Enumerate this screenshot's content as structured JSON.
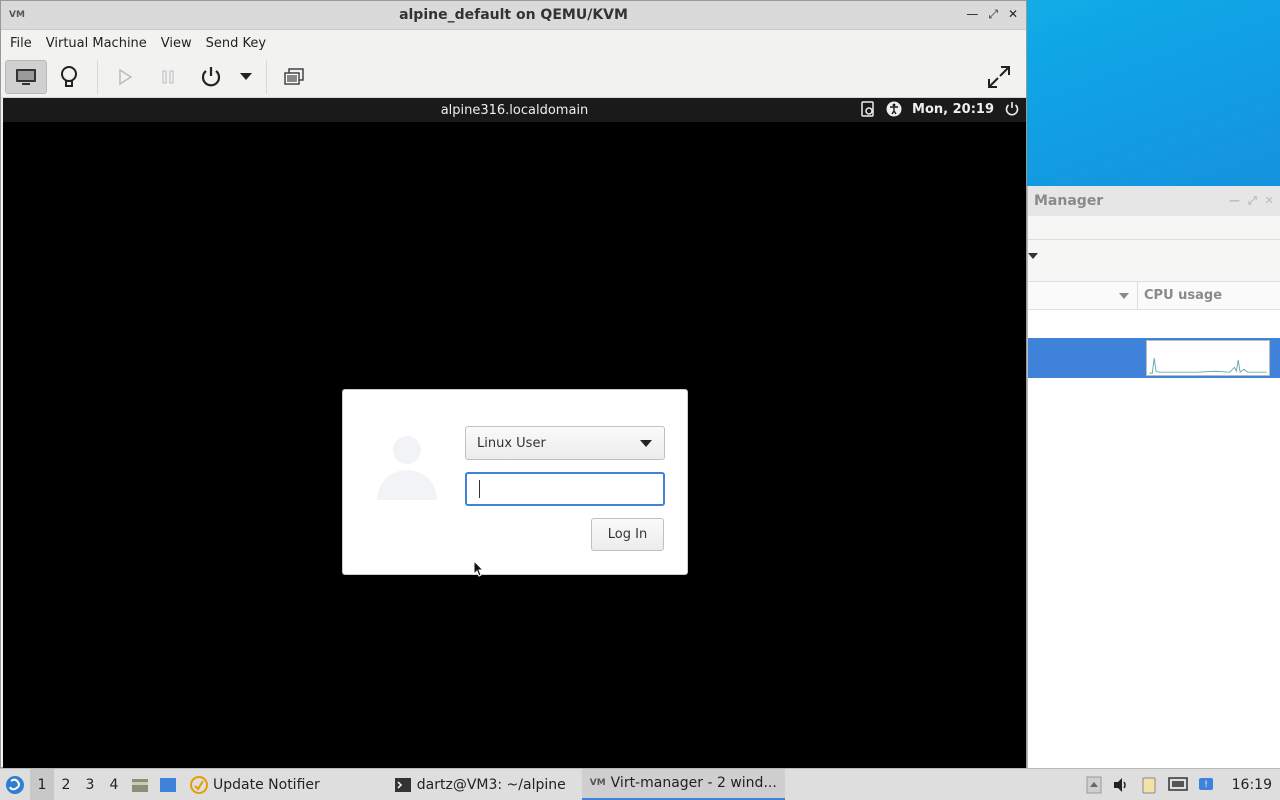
{
  "vm_window": {
    "title": "alpine_default on QEMU/KVM",
    "app_icon": "VM",
    "menu": [
      "File",
      "Virtual Machine",
      "View",
      "Send Key"
    ]
  },
  "guest": {
    "hostname": "alpine316.localdomain",
    "clock": "Mon, 20:19",
    "login": {
      "user": "Linux User",
      "password_value": "",
      "login_label": "Log In"
    }
  },
  "manager": {
    "title": "Manager",
    "column_cpu": "CPU usage"
  },
  "taskbar": {
    "workspaces": [
      "1",
      "2",
      "3",
      "4"
    ],
    "tasks": [
      {
        "label": "Update Notifier"
      },
      {
        "label": "dartz@VM3: ~/alpine"
      },
      {
        "label": "Virt-manager - 2 wind..."
      }
    ],
    "clock": "16:19"
  },
  "colors": {
    "accent": "#3f82d9",
    "guest_bg": "#000000"
  }
}
